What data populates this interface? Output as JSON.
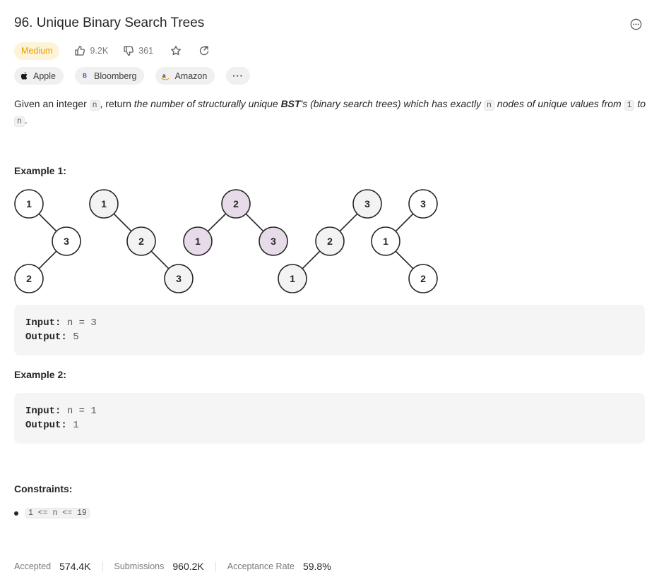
{
  "problem": {
    "title": "96. Unique Binary Search Trees",
    "difficulty": "Medium",
    "likes": "9.2K",
    "dislikes": "361"
  },
  "companies": [
    {
      "name": "Apple",
      "icon": "apple-icon"
    },
    {
      "name": "Bloomberg",
      "icon": "bloomberg-icon"
    },
    {
      "name": "Amazon",
      "icon": "amazon-icon"
    }
  ],
  "more_companies_label": "···",
  "description": {
    "p1": "Given an integer ",
    "n": "n",
    "p2": ", return ",
    "italic1": "the number of structurally unique ",
    "bst": "BST",
    "italic2": "'s (binary search trees) which has exactly ",
    "italic3": " nodes of unique values from ",
    "one": "1",
    "italic4": " to",
    "end": "."
  },
  "examples": [
    {
      "heading": "Example 1:",
      "input_label": "Input:",
      "input_value": "n = 3",
      "output_label": "Output:",
      "output_value": "5"
    },
    {
      "heading": "Example 2:",
      "input_label": "Input:",
      "input_value": "n = 1",
      "output_label": "Output:",
      "output_value": "1"
    }
  ],
  "trees": [
    {
      "nodes": [
        "1",
        "3",
        "2"
      ],
      "highlight": false
    },
    {
      "nodes": [
        "1",
        "2",
        "3"
      ],
      "highlight": false
    },
    {
      "nodes": [
        "2",
        "1",
        "3"
      ],
      "highlight": true
    },
    {
      "nodes": [
        "3",
        "2",
        "1"
      ],
      "highlight": false
    },
    {
      "nodes": [
        "3",
        "1",
        "2"
      ],
      "highlight": false
    }
  ],
  "colors": {
    "highlight_fill": "#e8dbe9",
    "node_fill": "#f3f3f3",
    "badge_text": "#e7a000"
  },
  "constraints": {
    "heading": "Constraints:",
    "items": [
      "1 <= n <= 19"
    ]
  },
  "stats": {
    "accepted_label": "Accepted",
    "accepted_value": "574.4K",
    "submissions_label": "Submissions",
    "submissions_value": "960.2K",
    "rate_label": "Acceptance Rate",
    "rate_value": "59.8%"
  }
}
